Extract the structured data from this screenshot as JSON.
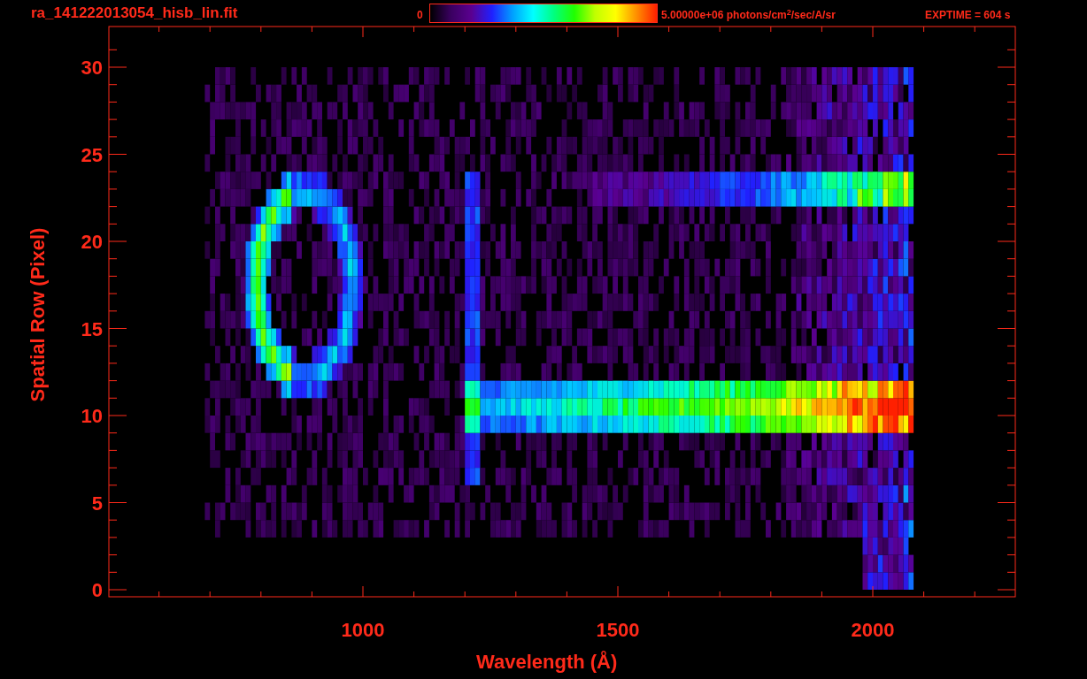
{
  "title": "ra_141222013054_hisb_lin.fit",
  "colorbar": {
    "min_label": "0",
    "max_label": "5.00000e+06 photons/cm$^{2}$/sec/A/sr"
  },
  "exposure": "EXPTIME = 604 s",
  "plot": {
    "xlabel": "Wavelength (Å)",
    "ylabel": "Spatial Row (Pixel)",
    "xtick_labels": [
      "1000",
      "1500",
      "2000"
    ],
    "ytick_labels": [
      "30",
      "25",
      "20",
      "15",
      "10",
      "5",
      "0"
    ]
  }
}
